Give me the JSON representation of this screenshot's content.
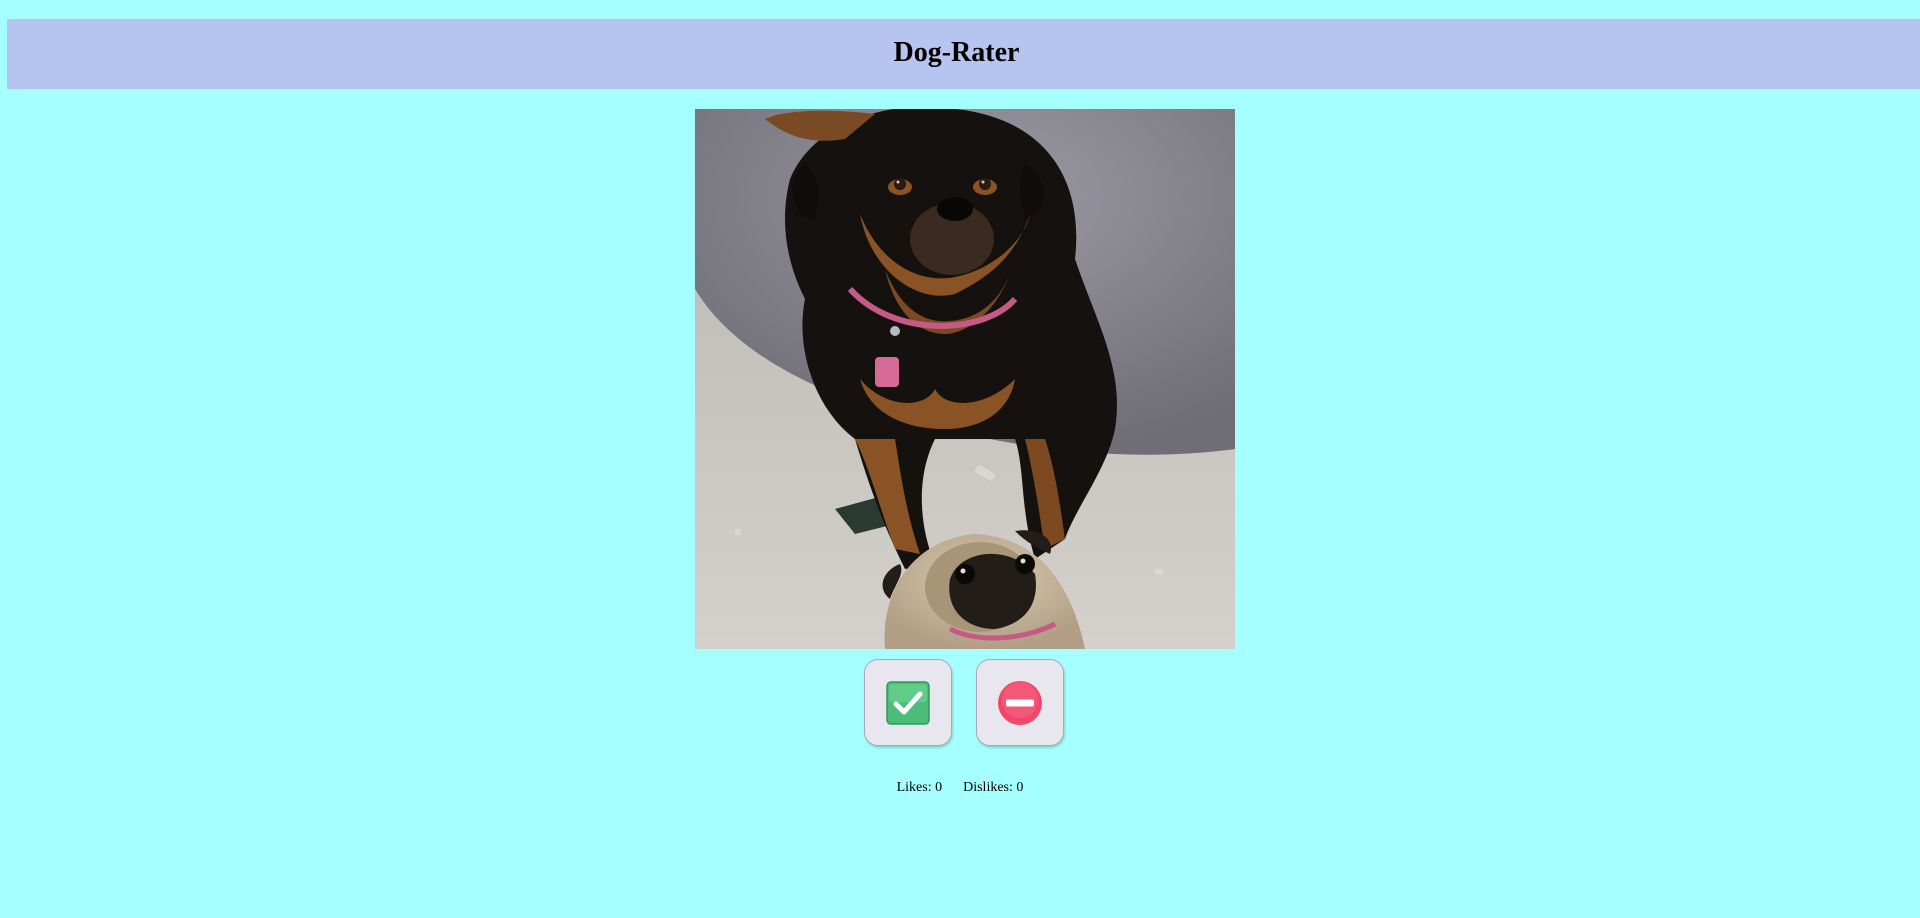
{
  "header": {
    "title": "Dog-Rater"
  },
  "photo": {
    "alt": "dog photo",
    "colors": {
      "floor": "#c9c6c0",
      "rug": "#8e8c95",
      "dog_black": "#15110f",
      "dog_tan": "#8a5325",
      "collar": "#c65a86",
      "pug_fawn": "#c8b8a0",
      "pug_mask": "#231d1a"
    }
  },
  "actions": {
    "like_icon": "check-mark-icon",
    "dislike_icon": "no-entry-icon",
    "like_color": "#4bbd78",
    "dislike_color": "#f0476a"
  },
  "stats": {
    "likes_label": "Likes:",
    "likes_count": "0",
    "dislikes_label": "Dislikes:",
    "dislikes_count": "0"
  }
}
